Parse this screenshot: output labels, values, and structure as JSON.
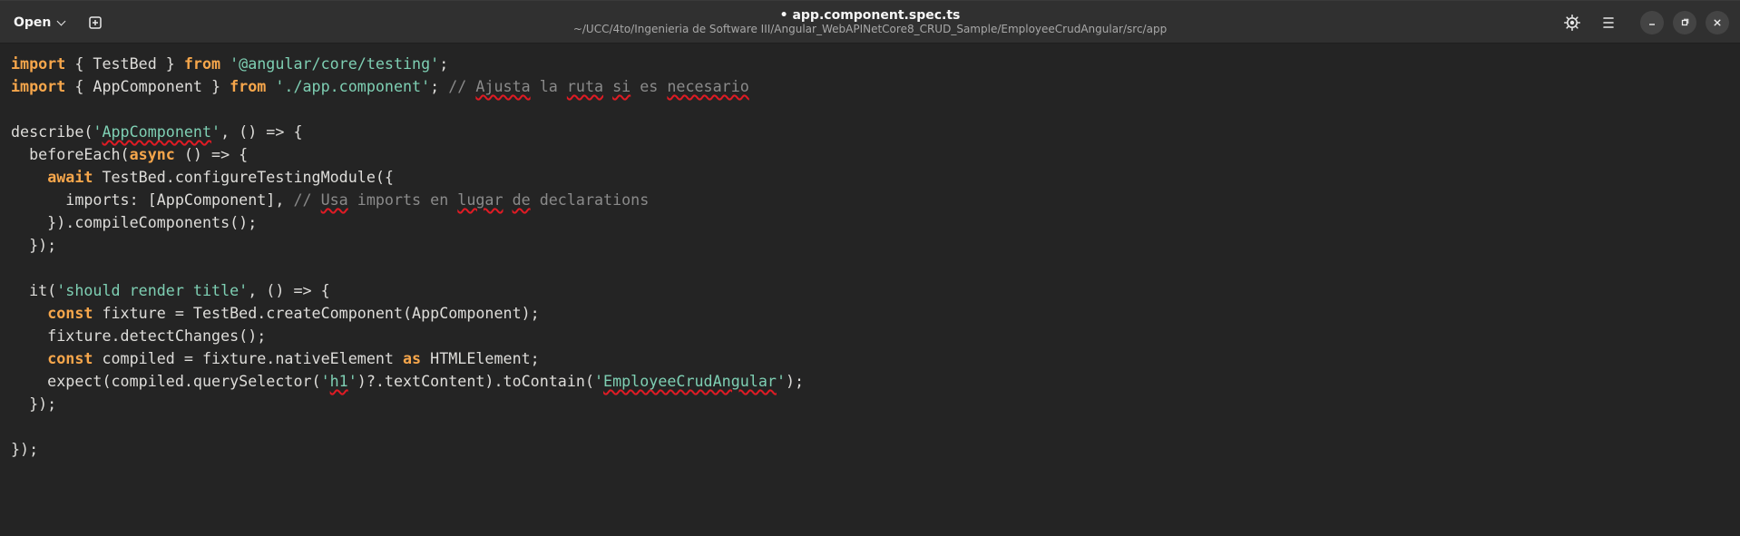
{
  "header": {
    "open_label": "Open",
    "title": "• app.component.spec.ts",
    "path": "~/UCC/4to/Ingenieria de Software III/Angular_WebAPINetCore8_CRUD_Sample/EmployeeCrudAngular/src/app",
    "icons": {
      "open_menu": "chevron-down-icon",
      "new_tab": "new-tab-icon",
      "settings": "brightness-icon",
      "menu": "hamburger-menu-icon",
      "minimize": "minimize-icon",
      "maximize": "maximize-icon",
      "close": "close-icon"
    }
  },
  "colors": {
    "keyword": "#f6a64b",
    "string": "#7ecfb3",
    "comment": "#8a8a8a",
    "text": "#deddda",
    "background": "#242424",
    "headerbar": "#303030",
    "spell_error": "#e01b24"
  },
  "code": {
    "l1": {
      "kw1": "import",
      "t1": " { TestBed } ",
      "kw2": "from",
      "t2": " ",
      "s1": "'@angular/core/testing'",
      "t3": ";"
    },
    "l2": {
      "kw1": "import",
      "t1": " { AppComponent } ",
      "kw2": "from",
      "t2": " ",
      "s1": "'./app.component'",
      "t3": "; ",
      "c1": "// ",
      "c2": "Ajusta",
      "c3": " la ",
      "c4": "ruta",
      "c5": " ",
      "c6": "si",
      "c7": " es ",
      "c8": "necesario"
    },
    "l4": {
      "t1": "describe(",
      "s1": "'",
      "s2": "AppComponent",
      "s3": "'",
      "t2": ", () => {"
    },
    "l5": {
      "t1": "  beforeEach(",
      "kw1": "async",
      "t2": " () => {"
    },
    "l6": {
      "t1": "    ",
      "kw1": "await",
      "t2": " TestBed.configureTestingModule({"
    },
    "l7": {
      "t1": "      imports: [AppComponent], ",
      "c1": "// ",
      "c2": "Usa",
      "c3": " imports en ",
      "c4": "lugar",
      "c5": " ",
      "c6": "de",
      "c7": " declarations"
    },
    "l8": {
      "t1": "    }).compileComponents();"
    },
    "l9": {
      "t1": "  });"
    },
    "l11": {
      "t1": "  it(",
      "s1": "'should render title'",
      "t2": ", () => {"
    },
    "l12": {
      "t1": "    ",
      "kw1": "const",
      "t2": " fixture = TestBed.createComponent(AppComponent);"
    },
    "l13": {
      "t1": "    fixture.detectChanges();"
    },
    "l14": {
      "t1": "    ",
      "kw1": "const",
      "t2": " compiled = fixture.nativeElement ",
      "kw2": "as",
      "t3": " HTMLElement;"
    },
    "l15": {
      "t1": "    expect(compiled.querySelector(",
      "s1": "'",
      "s2": "h1",
      "s3": "'",
      "t2": ")?.textContent).toContain(",
      "s4": "'",
      "s5": "EmployeeCrudAngular",
      "s6": "'",
      "t3": ");"
    },
    "l16": {
      "t1": "  });"
    },
    "l18": {
      "t1": "});"
    }
  }
}
